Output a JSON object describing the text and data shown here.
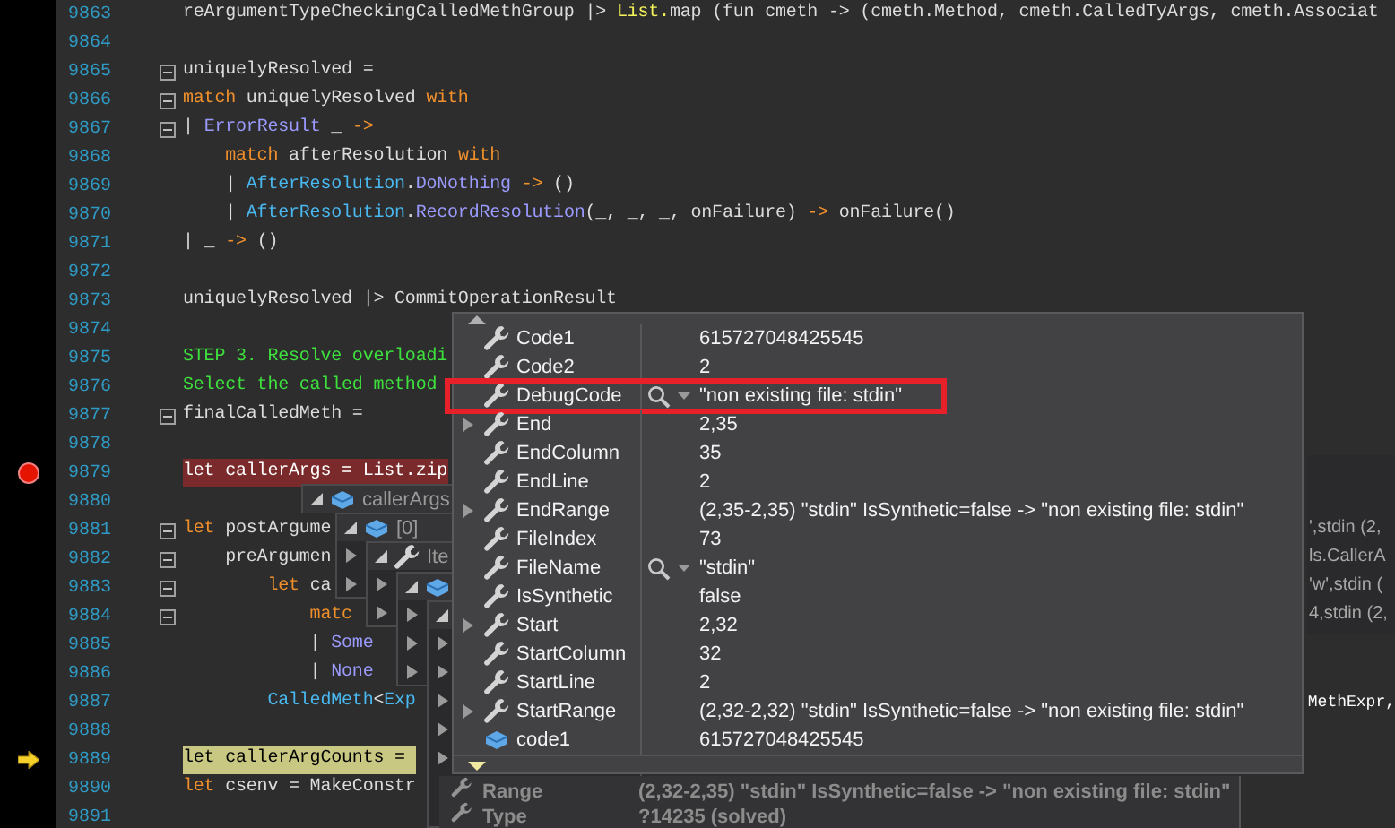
{
  "editor": {
    "lines": [
      {
        "number": "9863",
        "foldable": false,
        "tokens": [
          {
            "kind": "plain",
            "t": "reArgumentTypeCheckingCalledMethGroup |> "
          },
          {
            "kind": "fn",
            "t": "List."
          },
          {
            "kind": "plain",
            "t": "map (fun cmeth -> (cmeth.Method, cmeth.CalledTyArgs, cmeth.Associat"
          }
        ]
      },
      {
        "number": "9864",
        "foldable": false
      },
      {
        "number": "9865",
        "foldable": true,
        "tokens": [
          {
            "kind": "plain",
            "t": "uniquelyResolved ="
          }
        ]
      },
      {
        "number": "9866",
        "foldable": true,
        "tokens": [
          {
            "kind": "kw",
            "t": "match"
          },
          {
            "kind": "plain",
            "t": " uniquelyResolved "
          },
          {
            "kind": "kw",
            "t": "with"
          }
        ]
      },
      {
        "number": "9867",
        "foldable": true,
        "tokens": [
          {
            "kind": "plain",
            "t": "| "
          },
          {
            "kind": "type",
            "t": "ErrorResult"
          },
          {
            "kind": "plain",
            "t": " _ "
          },
          {
            "kind": "kw",
            "t": "->"
          }
        ]
      },
      {
        "number": "9868",
        "foldable": false,
        "tokens": [
          {
            "kind": "kw",
            "t": "    match"
          },
          {
            "kind": "plain",
            "t": " afterResolution "
          },
          {
            "kind": "kw",
            "t": "with"
          }
        ]
      },
      {
        "number": "9869",
        "foldable": false,
        "tokens": [
          {
            "kind": "plain",
            "t": "    | "
          },
          {
            "kind": "mod",
            "t": "AfterResolution"
          },
          {
            "kind": "plain",
            "t": "."
          },
          {
            "kind": "type",
            "t": "DoNothing"
          },
          {
            "kind": "kw",
            "t": " ->"
          },
          {
            "kind": "plain",
            "t": " ()"
          }
        ]
      },
      {
        "number": "9870",
        "foldable": false,
        "tokens": [
          {
            "kind": "plain",
            "t": "    | "
          },
          {
            "kind": "mod",
            "t": "AfterResolution"
          },
          {
            "kind": "plain",
            "t": "."
          },
          {
            "kind": "type",
            "t": "RecordResolution"
          },
          {
            "kind": "plain",
            "t": "(_, _, _, onFailure) "
          },
          {
            "kind": "kw",
            "t": "->"
          },
          {
            "kind": "plain",
            "t": " onFailure()"
          }
        ]
      },
      {
        "number": "9871",
        "foldable": false,
        "tokens": [
          {
            "kind": "plain",
            "t": "| _ "
          },
          {
            "kind": "kw",
            "t": "->"
          },
          {
            "kind": "plain",
            "t": " ()"
          }
        ]
      },
      {
        "number": "9872",
        "foldable": false
      },
      {
        "number": "9873",
        "foldable": false,
        "tokens": [
          {
            "kind": "plain",
            "t": "uniquelyResolved |> CommitOperationResult"
          }
        ]
      },
      {
        "number": "9874",
        "foldable": false
      },
      {
        "number": "9875",
        "foldable": false,
        "tokens": [
          {
            "kind": "comment",
            "t": "STEP 3. Resolve overloadi"
          }
        ]
      },
      {
        "number": "9876",
        "foldable": false,
        "tokens": [
          {
            "kind": "comment",
            "t": "Select the called method"
          }
        ]
      },
      {
        "number": "9877",
        "foldable": true,
        "tokens": [
          {
            "kind": "plain",
            "t": "finalCalledMeth ="
          }
        ]
      },
      {
        "number": "9878",
        "foldable": false
      },
      {
        "number": "9879",
        "foldable": false,
        "breakpoint": true,
        "tokens": [
          {
            "kind": "kw",
            "t": "let"
          },
          {
            "kind": "plain",
            "t": " callerArgs = List.zip"
          }
        ]
      },
      {
        "number": "9880",
        "foldable": false
      },
      {
        "number": "9881",
        "foldable": true,
        "tokens": [
          {
            "kind": "kw",
            "t": "let"
          },
          {
            "kind": "plain",
            "t": " postArgume"
          }
        ]
      },
      {
        "number": "9882",
        "foldable": true,
        "tokens": [
          {
            "kind": "plain",
            "t": "    preArgumen"
          }
        ]
      },
      {
        "number": "9883",
        "foldable": true,
        "tokens": [
          {
            "kind": "kw",
            "t": "        let"
          },
          {
            "kind": "plain",
            "t": " ca"
          }
        ]
      },
      {
        "number": "9884",
        "foldable": true,
        "tokens": [
          {
            "kind": "kw",
            "t": "            matc"
          }
        ]
      },
      {
        "number": "9885",
        "foldable": false,
        "tokens": [
          {
            "kind": "plain",
            "t": "            | "
          },
          {
            "kind": "type",
            "t": "Some"
          }
        ]
      },
      {
        "number": "9886",
        "foldable": false,
        "tokens": [
          {
            "kind": "plain",
            "t": "            | "
          },
          {
            "kind": "type",
            "t": "None"
          }
        ]
      },
      {
        "number": "9887",
        "foldable": false,
        "tokens": [
          {
            "kind": "mod",
            "t": "        CalledMeth"
          },
          {
            "kind": "plain",
            "t": "<"
          },
          {
            "kind": "mod",
            "t": "Exp"
          }
        ],
        "tail": "MethExpr,"
      },
      {
        "number": "9888",
        "foldable": false
      },
      {
        "number": "9889",
        "foldable": false,
        "current": true,
        "tokens": [
          {
            "kind": "kw",
            "t": "let"
          },
          {
            "kind": "plain",
            "t": " callerArgCounts = "
          }
        ]
      },
      {
        "number": "9890",
        "foldable": false,
        "tokens": [
          {
            "kind": "kw",
            "t": "let"
          },
          {
            "kind": "plain",
            "t": " csenv = MakeConstr"
          }
        ]
      },
      {
        "number": "9891",
        "foldable": false
      }
    ]
  },
  "cascade": [
    {
      "label": "callerArgs",
      "kind": "field",
      "expanded": true
    },
    {
      "label": "[0]",
      "kind": "field",
      "expanded": true,
      "rows": [
        {
          "expanded": false
        },
        {
          "expanded": false
        }
      ]
    },
    {
      "label": "Ite",
      "kind": "property",
      "expanded": true,
      "rows": [
        {
          "expanded": false
        },
        {
          "expanded": false
        }
      ]
    },
    {
      "kind": "field",
      "expanded": true,
      "rows": [
        {
          "expanded": false
        },
        {
          "expanded": false
        },
        {
          "expanded": false
        }
      ]
    },
    {
      "expanded": true,
      "rows": [
        {
          "expanded": false
        },
        {
          "expanded": false
        },
        {
          "expanded": false
        },
        {
          "expanded": false
        },
        {
          "expanded": false
        }
      ]
    }
  ],
  "side_values": [
    "',stdin (2,",
    "ls.CallerA",
    "'w',stdin (",
    "4,stdin (2,"
  ],
  "back_panel": {
    "rows": [
      {
        "name": "Range",
        "kind": "property",
        "value": "(2,32-2,35) \"stdin\" IsSynthetic=false -> \"non existing file: stdin\""
      },
      {
        "name": "Type",
        "kind": "property",
        "value": "?14235 (solved)"
      }
    ]
  },
  "datatip": {
    "rows": [
      {
        "name": "Code1",
        "kind": "property",
        "value": "615727048425545",
        "expandable": false,
        "visualizer": false,
        "highlighted": false
      },
      {
        "name": "Code2",
        "kind": "property",
        "value": "2",
        "expandable": false,
        "visualizer": false,
        "highlighted": false
      },
      {
        "name": "DebugCode",
        "kind": "property",
        "value": "\"non existing file: stdin\"",
        "expandable": false,
        "visualizer": true,
        "highlighted": true
      },
      {
        "name": "End",
        "kind": "property",
        "value": "2,35",
        "expandable": true,
        "visualizer": false,
        "highlighted": false
      },
      {
        "name": "EndColumn",
        "kind": "property",
        "value": "35",
        "expandable": false,
        "visualizer": false,
        "highlighted": false
      },
      {
        "name": "EndLine",
        "kind": "property",
        "value": "2",
        "expandable": false,
        "visualizer": false,
        "highlighted": false
      },
      {
        "name": "EndRange",
        "kind": "property",
        "value": "(2,35-2,35) \"stdin\" IsSynthetic=false -> \"non existing file: stdin\"",
        "expandable": true,
        "visualizer": false,
        "highlighted": false
      },
      {
        "name": "FileIndex",
        "kind": "property",
        "value": "73",
        "expandable": false,
        "visualizer": false,
        "highlighted": false
      },
      {
        "name": "FileName",
        "kind": "property",
        "value": "\"stdin\"",
        "expandable": false,
        "visualizer": true,
        "highlighted": false
      },
      {
        "name": "IsSynthetic",
        "kind": "property",
        "value": "false",
        "expandable": false,
        "visualizer": false,
        "highlighted": false
      },
      {
        "name": "Start",
        "kind": "property",
        "value": "2,32",
        "expandable": true,
        "visualizer": false,
        "highlighted": false
      },
      {
        "name": "StartColumn",
        "kind": "property",
        "value": "32",
        "expandable": false,
        "visualizer": false,
        "highlighted": false
      },
      {
        "name": "StartLine",
        "kind": "property",
        "value": "2",
        "expandable": false,
        "visualizer": false,
        "highlighted": false
      },
      {
        "name": "StartRange",
        "kind": "property",
        "value": "(2,32-2,32) \"stdin\" IsSynthetic=false -> \"non existing file: stdin\"",
        "expandable": true,
        "visualizer": false,
        "highlighted": false
      },
      {
        "name": "code1",
        "kind": "field",
        "value": "615727048425545",
        "expandable": false,
        "visualizer": false,
        "highlighted": false
      }
    ]
  }
}
